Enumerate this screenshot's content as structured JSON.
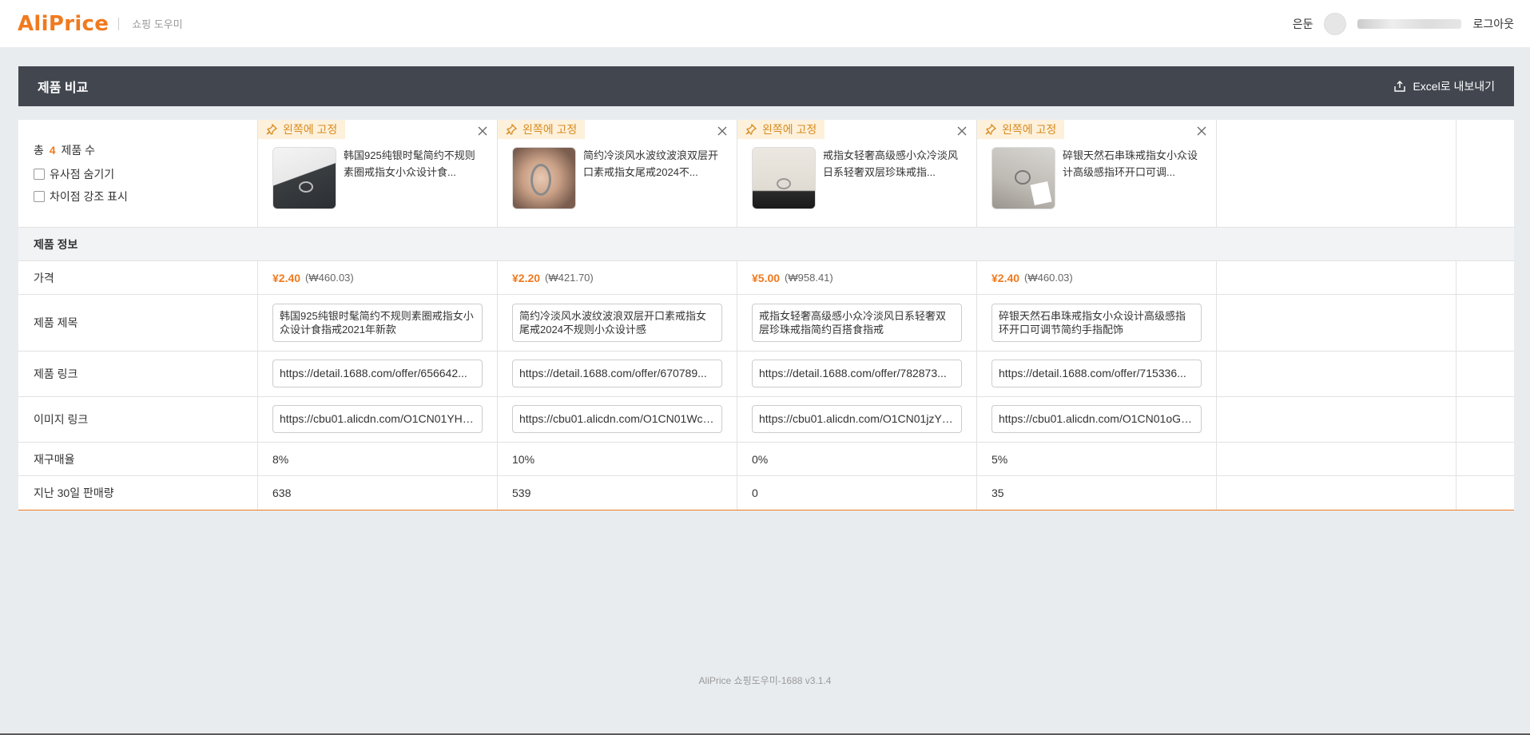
{
  "header": {
    "logo": "AliPrice",
    "subtitle": "쇼핑 도우미",
    "user_nick": "은둔",
    "logout": "로그아웃"
  },
  "panel": {
    "title": "제품 비교",
    "export_label": "Excel로 내보내기"
  },
  "summary": {
    "prefix": "총",
    "count": "4",
    "suffix": "제품 수",
    "hide_similar": "유사점 숨기기",
    "highlight_diff": "차이점 강조 표시"
  },
  "pin_label": "왼쪽에 고정",
  "section_label": "제품 정보",
  "row_labels": {
    "price": "가격",
    "title": "제품 제목",
    "link": "제품 링크",
    "image_link": "이미지 링크",
    "repurchase": "재구매율",
    "sales30": "지난 30일 판매량"
  },
  "products": [
    {
      "short_title": "韩国925纯银时髦简约不规则素圈戒指女小众设计食...",
      "price_cny": "¥2.40",
      "price_krw": "(₩460.03)",
      "full_title": "韩国925纯银时髦简约不规则素圈戒指女小众设计食指戒2021年新款",
      "link": "https://detail.1688.com/offer/656642...",
      "image_link": "https://cbu01.alicdn.com/O1CN01YHN...",
      "repurchase": "8%",
      "sales30": "638",
      "thumb_bg": "#3a3d40"
    },
    {
      "short_title": "简约冷淡风水波纹波浪双层开口素戒指女尾戒2024不...",
      "price_cny": "¥2.20",
      "price_krw": "(₩421.70)",
      "full_title": "简约冷淡风水波纹波浪双层开口素戒指女尾戒2024不规则小众设计感",
      "link": "https://detail.1688.com/offer/670789...",
      "image_link": "https://cbu01.alicdn.com/O1CN01WcJ...",
      "repurchase": "10%",
      "sales30": "539",
      "thumb_bg": "#b98f76"
    },
    {
      "short_title": "戒指女轻奢高级感小众冷淡风日系轻奢双层珍珠戒指...",
      "price_cny": "¥5.00",
      "price_krw": "(₩958.41)",
      "full_title": "戒指女轻奢高级感小众冷淡风日系轻奢双层珍珠戒指简约百搭食指戒",
      "link": "https://detail.1688.com/offer/782873...",
      "image_link": "https://cbu01.alicdn.com/O1CN01jzY4...",
      "repurchase": "0%",
      "sales30": "0",
      "thumb_bg": "#d9d4cb"
    },
    {
      "short_title": "碎银天然石串珠戒指女小众设计高级感指环开口可调...",
      "price_cny": "¥2.40",
      "price_krw": "(₩460.03)",
      "full_title": "碎银天然石串珠戒指女小众设计高级感指环开口可调节简约手指配饰",
      "link": "https://detail.1688.com/offer/715336...",
      "image_link": "https://cbu01.alicdn.com/O1CN01oGu...",
      "repurchase": "5%",
      "sales30": "35",
      "thumb_bg": "#c7c4bf"
    }
  ],
  "footer": "AliPrice 쇼핑도우미-1688 v3.1.4",
  "colors": {
    "accent": "#f07a1f",
    "panel_header": "#41464f",
    "pin_bg": "#fdf1dc"
  }
}
